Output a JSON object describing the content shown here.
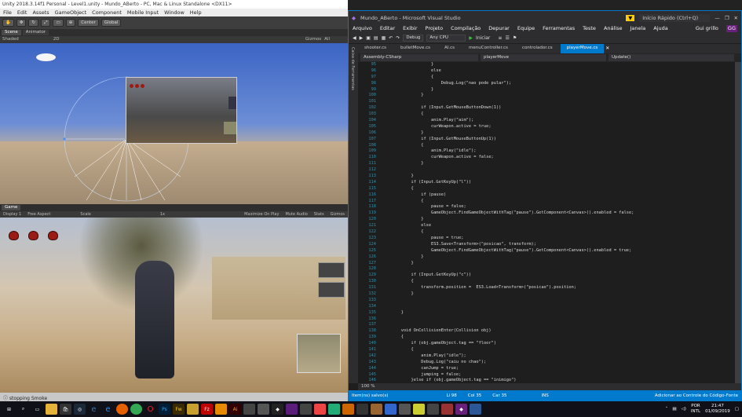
{
  "unity": {
    "title": "Unity 2018.3.14f1 Personal - Level1.unity - Mundo_ABerto - PC, Mac & Linux Standalone <DX11>",
    "menu": [
      "File",
      "Edit",
      "Assets",
      "GameObject",
      "Component",
      "Mobile Input",
      "Window",
      "Help"
    ],
    "toolbar": {
      "center": "Center",
      "global": "Global"
    },
    "scene_tabs": [
      "Scene",
      "Animator"
    ],
    "scene_bar": {
      "shaded": "Shaded",
      "mode2d": "2D",
      "gizmos": "Gizmos",
      "all": "All"
    },
    "game_tab": "Game",
    "game_bar": {
      "display": "Display 1",
      "aspect": "Free Aspect",
      "scale_label": "Scale",
      "scale_value": "1x",
      "maximize": "Maximize On Play",
      "mute": "Mute Audio",
      "stats": "Stats",
      "gizmos": "Gizmos"
    },
    "status": "stopping Smoke"
  },
  "vs": {
    "title": "Mundo_ABerto - Microsoft Visual Studio",
    "quick_launch": "Início Rápido (Ctrl+Q)",
    "user": "Gui grillo",
    "user_initials": "GG",
    "menu": [
      "Arquivo",
      "Editar",
      "Exibir",
      "Projeto",
      "Compilação",
      "Depurar",
      "Equipe",
      "Ferramentas",
      "Teste",
      "Análise",
      "Janela",
      "Ajuda"
    ],
    "config": "Debug",
    "platform": "Any CPU",
    "start": "Iniciar",
    "tabs": [
      "shooter.cs",
      "bulletMove.cs",
      "AI.cs",
      "menuController.cs",
      "controlador.cs",
      "playerMove.cs"
    ],
    "active_tab": "playerMove.cs",
    "side_label": "Caixa de Ferramentas",
    "nav": [
      "Assembly-CSharp",
      "playerMove",
      "Update()"
    ],
    "zoom": "100 %",
    "status": {
      "items": "Item(ns) salvo(s)",
      "line": "Li 98",
      "col": "Col 35",
      "char": "Car 35",
      "ins": "INS",
      "source_control": "Adicionar ao Controle do Código-Fonte"
    },
    "code": [
      {
        "n": "95",
        "t": "                }"
      },
      {
        "n": "96",
        "t": "                else"
      },
      {
        "n": "97",
        "t": "                {"
      },
      {
        "n": "98",
        "t": "                    Debug.Log(\"nao pode pular\");"
      },
      {
        "n": "99",
        "t": "                }"
      },
      {
        "n": "100",
        "t": "            }"
      },
      {
        "n": "101",
        "t": ""
      },
      {
        "n": "102",
        "t": "            if (Input.GetMouseButtonDown(1))"
      },
      {
        "n": "103",
        "t": "            {"
      },
      {
        "n": "104",
        "t": "                anim.Play(\"aim\");"
      },
      {
        "n": "105",
        "t": "                curWeapon.active = true;"
      },
      {
        "n": "106",
        "t": "            }"
      },
      {
        "n": "107",
        "t": "            if (Input.GetMouseButtonUp(1))"
      },
      {
        "n": "108",
        "t": "            {"
      },
      {
        "n": "109",
        "t": "                anim.Play(\"idle\");"
      },
      {
        "n": "110",
        "t": "                curWeapon.active = false;"
      },
      {
        "n": "111",
        "t": "            }"
      },
      {
        "n": "112",
        "t": ""
      },
      {
        "n": "113",
        "t": "        }"
      },
      {
        "n": "114",
        "t": "        if (Input.GetKeyUp(\"l\"))"
      },
      {
        "n": "115",
        "t": "        {"
      },
      {
        "n": "116",
        "t": "            if (pause)"
      },
      {
        "n": "117",
        "t": "            {"
      },
      {
        "n": "118",
        "t": "                pause = false;"
      },
      {
        "n": "119",
        "t": "                GameObject.FindGameObjectWithTag(\"pause\").GetComponent<Canvas>().enabled = false;"
      },
      {
        "n": "120",
        "t": "            }"
      },
      {
        "n": "121",
        "t": "            else"
      },
      {
        "n": "122",
        "t": "            {"
      },
      {
        "n": "123",
        "t": "                pause = true;"
      },
      {
        "n": "124",
        "t": "                ES3.Save<Transform>(\"posicao\", transform);"
      },
      {
        "n": "125",
        "t": "                GameObject.FindGameObjectWithTag(\"pause\").GetComponent<Canvas>().enabled = true;"
      },
      {
        "n": "126",
        "t": "            }"
      },
      {
        "n": "127",
        "t": "        }"
      },
      {
        "n": "128",
        "t": ""
      },
      {
        "n": "129",
        "t": "        if (Input.GetKeyUp(\"c\"))"
      },
      {
        "n": "130",
        "t": "        {"
      },
      {
        "n": "131",
        "t": "            transform.position =  ES3.Load<Transform>(\"posicao\").position;"
      },
      {
        "n": "132",
        "t": "        }"
      },
      {
        "n": "133",
        "t": ""
      },
      {
        "n": "134",
        "t": ""
      },
      {
        "n": "135",
        "t": "    }"
      },
      {
        "n": "136",
        "t": ""
      },
      {
        "n": "137",
        "t": ""
      },
      {
        "n": "138",
        "t": "    void OnCollisionEnter(Collision obj)"
      },
      {
        "n": "139",
        "t": "    {"
      },
      {
        "n": "140",
        "t": "        if (obj.gameObject.tag == \"floor\")"
      },
      {
        "n": "141",
        "t": "        {"
      },
      {
        "n": "142",
        "t": "            anim.Play(\"idle\");"
      },
      {
        "n": "143",
        "t": "            Debug.Log(\"caiu no chao\");"
      },
      {
        "n": "144",
        "t": "            canJump = true;"
      },
      {
        "n": "145",
        "t": "            jumping = false;"
      },
      {
        "n": "146",
        "t": "        }else if (obj.gameObject.tag == \"inimigo\")"
      }
    ]
  },
  "taskbar": {
    "lang": "POR",
    "kbd": "INTL",
    "time": "21:47",
    "date": "01/09/2019"
  }
}
